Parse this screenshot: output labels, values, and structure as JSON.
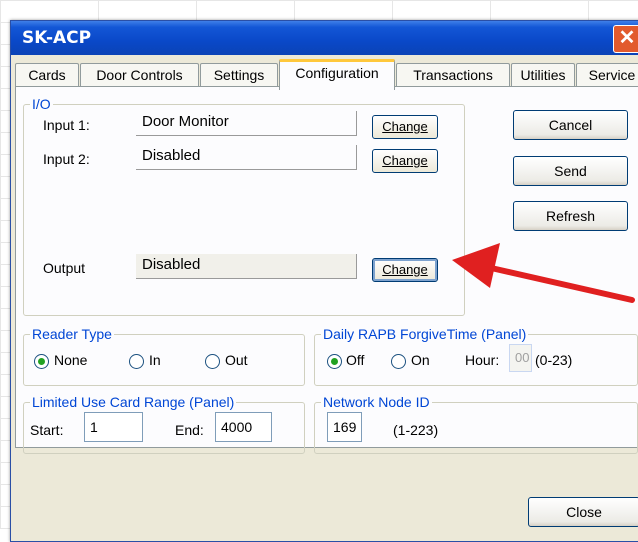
{
  "window": {
    "title": "SK-ACP",
    "close_glyph": "✕"
  },
  "tabs": [
    {
      "label": "Cards"
    },
    {
      "label": "Door Controls"
    },
    {
      "label": "Settings"
    },
    {
      "label": "Configuration"
    },
    {
      "label": "Transactions"
    },
    {
      "label": "Utilities"
    },
    {
      "label": "Service"
    }
  ],
  "io": {
    "legend": "I/O",
    "input1": {
      "label": "Input 1:",
      "value": "Door Monitor",
      "button": "Change"
    },
    "input2": {
      "label": "Input 2:",
      "value": "Disabled",
      "button": "Change"
    },
    "output": {
      "label": "Output",
      "value": "Disabled",
      "button": "Change"
    }
  },
  "side_buttons": {
    "cancel": "Cancel",
    "send": "Send",
    "refresh": "Refresh"
  },
  "reader_type": {
    "legend": "Reader Type",
    "none": "None",
    "in": "In",
    "out": "Out",
    "selected": "None"
  },
  "rapb": {
    "legend": "Daily RAPB ForgiveTime (Panel)",
    "off": "Off",
    "on": "On",
    "selected": "Off",
    "hour_label": "Hour:",
    "hour_value": "00",
    "hour_range": "(0-23)"
  },
  "card_range": {
    "legend": "Limited Use Card Range (Panel)",
    "start_label": "Start:",
    "start_value": "1",
    "end_label": "End:",
    "end_value": "4000"
  },
  "node": {
    "legend": "Network Node ID",
    "value": "169",
    "range": "(1-223)"
  },
  "footer": {
    "close": "Close"
  },
  "colors": {
    "title_bar": "#0b4fd0",
    "legend_text": "#0046d5",
    "active_tab_accent": "#ffc83c",
    "arrow": "#e02020"
  }
}
